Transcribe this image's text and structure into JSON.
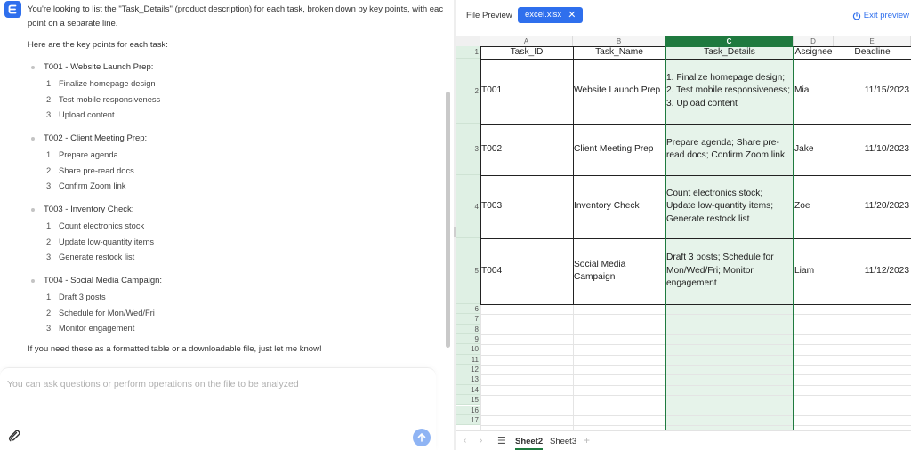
{
  "chat": {
    "intro_line1": "You're looking to list the \"Task_Details\" (product description) for each task, broken down by key points, with eac",
    "intro_line2": "point on a separate line.",
    "intro_key_points": "Here are the key points for each task:",
    "tasks": [
      {
        "title": "T001 - Website Launch Prep:",
        "items": [
          "Finalize homepage design",
          "Test mobile responsiveness",
          "Upload content"
        ]
      },
      {
        "title": "T002 - Client Meeting Prep:",
        "items": [
          "Prepare agenda",
          "Share pre-read docs",
          "Confirm Zoom link"
        ]
      },
      {
        "title": "T003 - Inventory Check:",
        "items": [
          "Count electronics stock",
          "Update low-quantity items",
          "Generate restock list"
        ]
      },
      {
        "title": "T004 - Social Media Campaign:",
        "items": [
          "Draft 3 posts",
          "Schedule for Mon/Wed/Fri",
          "Monitor engagement"
        ]
      }
    ],
    "outro": "If you need these as a formatted table or a downloadable file, just let me know!",
    "input_placeholder": "You can ask questions or perform operations on the file to be analyzed"
  },
  "preview": {
    "title": "File Preview",
    "file_tab": "excel.xlsx",
    "exit_label": "Exit preview",
    "columns": [
      "A",
      "B",
      "C",
      "D",
      "E"
    ],
    "selected_column": "C",
    "header_row": [
      "Task_ID",
      "Task_Name",
      "Task_Details",
      "Assignee",
      "Deadline"
    ],
    "rows": [
      {
        "id": "T001",
        "name": "Website Launch Prep",
        "details": "1. Finalize homepage design; 2. Test mobile responsiveness; 3. Upload content",
        "assignee": "Mia",
        "deadline": "11/15/2023"
      },
      {
        "id": "T002",
        "name": "Client Meeting Prep",
        "details": "Prepare agenda; Share pre-read docs; Confirm Zoom link",
        "assignee": "Jake",
        "deadline": "11/10/2023"
      },
      {
        "id": "T003",
        "name": "Inventory Check",
        "details": "Count electronics stock; Update low-quantity items; Generate restock list",
        "assignee": "Zoe",
        "deadline": "11/20/2023"
      },
      {
        "id": "T004",
        "name": "Social Media Campaign",
        "details": "Draft 3 posts; Schedule for Mon/Wed/Fri; Monitor engagement",
        "assignee": "Liam",
        "deadline": "11/12/2023"
      }
    ],
    "row_numbers": [
      "1",
      "2",
      "3",
      "4",
      "5",
      "6",
      "7",
      "8",
      "9",
      "10",
      "11",
      "12",
      "13",
      "14",
      "15",
      "16",
      "17"
    ],
    "sheets": [
      "Sheet2",
      "Sheet3"
    ],
    "active_sheet": "Sheet2"
  },
  "colors": {
    "accent": "#2f6fed",
    "excel_green": "#1f7a3f",
    "selection_fill": "#e6f3ea"
  }
}
